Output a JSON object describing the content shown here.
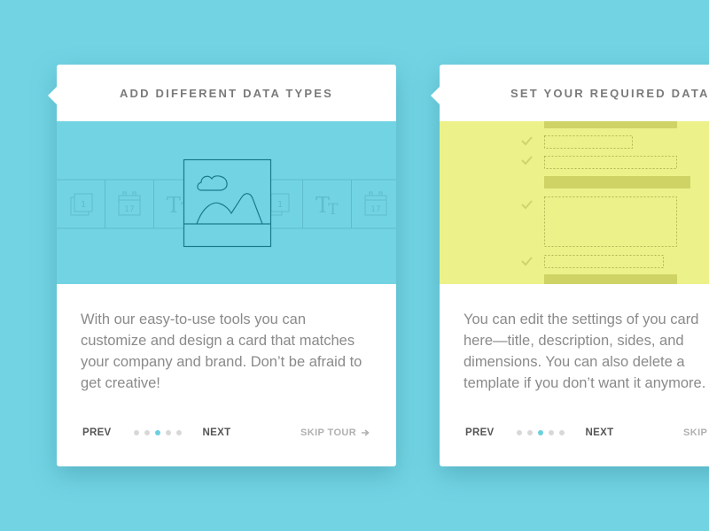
{
  "background_color": "#72d4e3",
  "cards": [
    {
      "title": "ADD DIFFERENT DATA TYPES",
      "illustration": "data-types-carousel",
      "illustration_bg": "#72d4e3",
      "carousel_items": [
        "copy-icon",
        "calendar-icon",
        "text-size-icon",
        "image-icon",
        "copy-icon",
        "text-size-icon",
        "calendar-icon"
      ],
      "calendar_day": "17",
      "copy_number": "1",
      "text_icon_glyph": "Tт",
      "description": "With our easy-to-use tools you can customize and design a card that matches your company and brand. Don’t be afraid to get creative!",
      "footer": {
        "prev_label": "PREV",
        "next_label": "NEXT",
        "skip_label": "SKIP TOUR",
        "skip_icon": "arrow-right-icon",
        "step_count": 5,
        "current_step": 3
      }
    },
    {
      "title": "SET YOUR REQUIRED DATA",
      "illustration": "required-fields-form",
      "illustration_bg": "#ecf18a",
      "description_lines": [
        "You can edit the settings of you card",
        "here—title, description, sides, and",
        "dimensions. You can also delete a",
        "template if you don’t want it anymore."
      ],
      "footer": {
        "prev_label": "PREV",
        "next_label": "NEXT",
        "skip_label": "SKIP TOUR",
        "step_count": 5,
        "current_step": 3
      }
    }
  ],
  "colors": {
    "accent": "#6ccfe0",
    "dot_inactive": "#d8d8d8",
    "title_text": "#7a7a7a",
    "body_text": "#8a8a8a",
    "yellow_bar": "#cfd366",
    "image_stroke": "#1a7a8c"
  }
}
